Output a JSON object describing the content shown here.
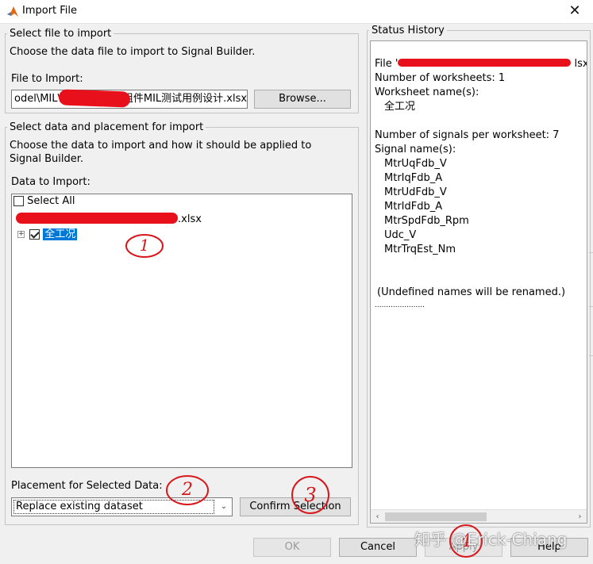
{
  "window": {
    "title": "Import File",
    "close_glyph": "✕",
    "accent_color": "#0078d7",
    "icon": "matlab-icon"
  },
  "file_group": {
    "legend": "Select file to import",
    "description": "Choose the data file to import to Signal Builder.",
    "file_label": "File to Import:",
    "file_value_start": "odel\\MIL\\",
    "file_value_end": "组件MIL测试用例设计.xlsx",
    "browse_label": "Browse..."
  },
  "data_group": {
    "legend": "Select data and placement for import",
    "description": "Choose the data to import and how it should be applied to Signal Builder.",
    "data_label": "Data to Import:",
    "select_all_label": "Select All",
    "file_node_suffix": ".xlsx",
    "sheet_node_label": "全工况",
    "placement_label": "Placement for Selected Data:",
    "placement_value": "Replace existing dataset",
    "confirm_label": "Confirm Selection"
  },
  "status": {
    "legend": "Status History",
    "file_prefix": "File '",
    "file_suffix": "lsx'",
    "worksheets_count": "Number of worksheets: 1",
    "worksheet_names_label": "Worksheet name(s):",
    "worksheet_name": "全工况",
    "signals_count": "Number of signals per worksheet: 7",
    "signal_names_label": "Signal name(s):",
    "signals": [
      "MtrUqFdb_V",
      "MtrIqFdb_A",
      "MtrUdFdb_V",
      "MtrIdFdb_A",
      "MtrSpdFdb_Rpm",
      "Udc_V",
      "MtrTrqEst_Nm"
    ],
    "note": "(Undefined names will be renamed.)",
    "separator": "......................"
  },
  "buttons": {
    "ok": "OK",
    "cancel": "Cancel",
    "apply": "Apply",
    "help": "Help"
  },
  "annotations": [
    "1",
    "2",
    "3",
    "4"
  ],
  "watermark": "知乎 @Erick-Chiang"
}
